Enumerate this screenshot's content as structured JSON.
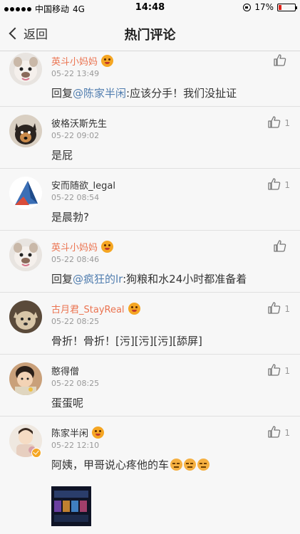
{
  "status_bar": {
    "carrier": "中国移动",
    "network": "4G",
    "time": "14:48",
    "battery_percent": "17%",
    "battery_level": 0.17
  },
  "nav": {
    "back_label": "返回",
    "title": "热门评论"
  },
  "comments": [
    {
      "username": "英斗小妈妈",
      "username_style": "orange",
      "has_badge": true,
      "time": "05-22 13:49",
      "reply_prefix": "回复",
      "mention": "@陈家半闲",
      "text": ":应该分手！我们没扯证",
      "likes": ""
    },
    {
      "username": "彼格沃斯先生",
      "username_style": "normal",
      "has_badge": false,
      "time": "05-22 09:02",
      "text": "是屁",
      "likes": "1"
    },
    {
      "username": "安而随欲_legal",
      "username_style": "normal",
      "has_badge": false,
      "time": "05-22 08:54",
      "text": "是晨勃?",
      "likes": "1"
    },
    {
      "username": "英斗小妈妈",
      "username_style": "orange",
      "has_badge": true,
      "time": "05-22 08:46",
      "reply_prefix": "回复",
      "mention": "@疯狂的lr",
      "text": ":狗粮和水24小时都准备着",
      "likes": ""
    },
    {
      "username": "古月君_StayReal",
      "username_style": "orange",
      "has_badge": true,
      "time": "05-22 08:25",
      "text": "骨折！骨折！[污][污][污][舔屏]",
      "likes": "1"
    },
    {
      "username": "憨得僧",
      "username_style": "normal",
      "has_badge": false,
      "time": "05-22 08:25",
      "text": "蛋蛋呢",
      "likes": "1"
    },
    {
      "username": "陈家半闲",
      "username_style": "normal",
      "has_badge": true,
      "time": "05-22 12:10",
      "text": "阿姨，甲哥说心疼他的车",
      "likes": "1",
      "has_image": true
    }
  ],
  "colors": {
    "orange_name": "#eb7350",
    "mention_blue": "#507daf",
    "battery_red": "#e2231a"
  }
}
